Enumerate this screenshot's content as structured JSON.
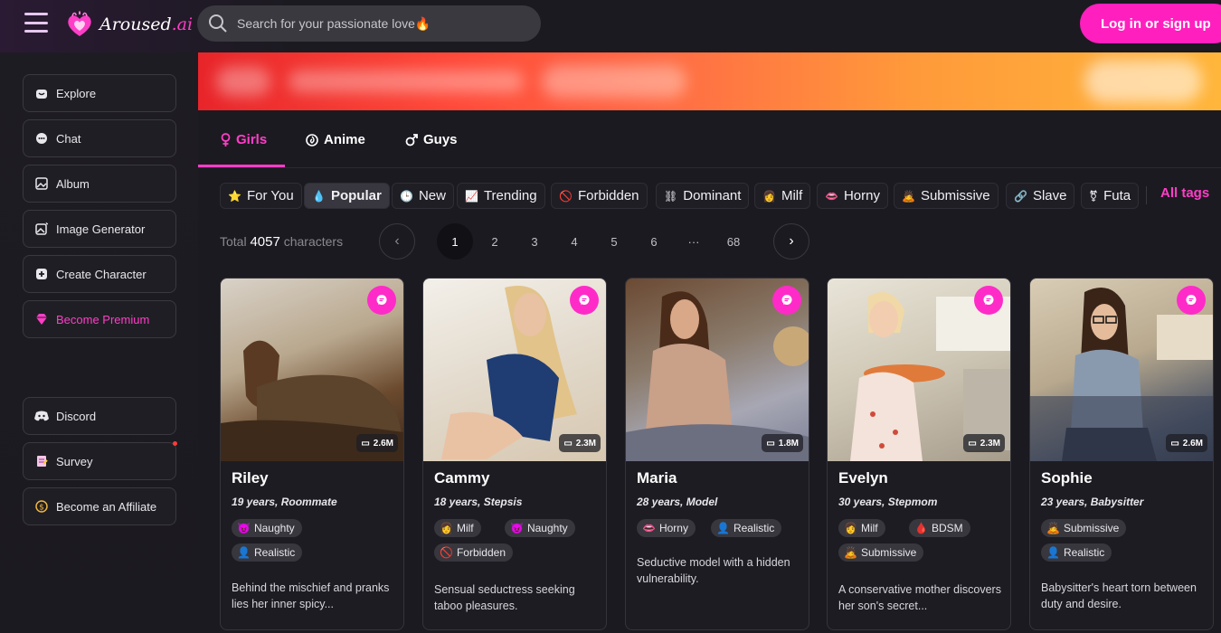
{
  "header": {
    "logo_text": "Aroused",
    "logo_suffix": ".ai",
    "search_placeholder": "Search for your passionate love🔥",
    "login_label": "Log in or sign up"
  },
  "sidebar": {
    "items": [
      {
        "label": "Explore",
        "icon": "home-icon"
      },
      {
        "label": "Chat",
        "icon": "chat-icon"
      },
      {
        "label": "Album",
        "icon": "album-icon"
      },
      {
        "label": "Image Generator",
        "icon": "image-generator-icon"
      },
      {
        "label": "Create Character",
        "icon": "plus-icon"
      },
      {
        "label": "Become Premium",
        "icon": "diamond-icon"
      },
      {
        "label": "Discord",
        "icon": "discord-icon"
      },
      {
        "label": "Survey",
        "icon": "survey-icon"
      },
      {
        "label": "Become an Affiliate",
        "icon": "dollar-icon"
      }
    ]
  },
  "tabs": [
    {
      "label": "Girls",
      "icon": "female-icon"
    },
    {
      "label": "Anime",
      "icon": "anime-icon"
    },
    {
      "label": "Guys",
      "icon": "male-icon"
    }
  ],
  "tags": [
    {
      "label": "For You",
      "emoji": "⭐"
    },
    {
      "label": "Popular",
      "emoji": "💧"
    },
    {
      "label": "New",
      "emoji": "🕒"
    },
    {
      "label": "Trending",
      "emoji": "📈"
    },
    {
      "label": "Forbidden",
      "emoji": "🚫"
    },
    {
      "label": "Dominant",
      "emoji": "⛓"
    },
    {
      "label": "Milf",
      "emoji": "👩"
    },
    {
      "label": "Horny",
      "emoji": "👄"
    },
    {
      "label": "Submissive",
      "emoji": "🙇"
    },
    {
      "label": "Slave",
      "emoji": "🔗"
    },
    {
      "label": "Futa",
      "emoji": "⚧"
    }
  ],
  "all_tags_label": "All tags",
  "total": {
    "prefix": "Total",
    "count": "4057",
    "suffix": "characters"
  },
  "pagination": {
    "pages": [
      "1",
      "2",
      "3",
      "4",
      "5",
      "6",
      "···",
      "68"
    ],
    "current": "1",
    "prev": "‹",
    "next": "›"
  },
  "cards": [
    {
      "name": "Riley",
      "meta": "19 years, Roommate",
      "count": "2.6M",
      "tags": [
        {
          "label": "Naughty",
          "emoji": "😈"
        },
        {
          "label": "Realistic",
          "emoji": "👤"
        }
      ],
      "desc": "Behind the mischief and pranks lies her inner spicy..."
    },
    {
      "name": "Cammy",
      "meta": "18 years, Stepsis",
      "count": "2.3M",
      "tags": [
        {
          "label": "Milf",
          "emoji": "👩"
        },
        {
          "label": "Naughty",
          "emoji": "😈"
        },
        {
          "label": "Forbidden",
          "emoji": "🚫"
        }
      ],
      "desc": "Sensual seductress seeking taboo pleasures."
    },
    {
      "name": "Maria",
      "meta": "28 years, Model",
      "count": "1.8M",
      "tags": [
        {
          "label": "Horny",
          "emoji": "👄"
        },
        {
          "label": "Realistic",
          "emoji": "👤"
        }
      ],
      "desc": "Seductive model with a hidden vulnerability."
    },
    {
      "name": "Evelyn",
      "meta": "30 years, Stepmom",
      "count": "2.3M",
      "tags": [
        {
          "label": "Milf",
          "emoji": "👩"
        },
        {
          "label": "BDSM",
          "emoji": "🩸"
        },
        {
          "label": "Submissive",
          "emoji": "🙇"
        }
      ],
      "desc": "A conservative mother discovers her son's secret..."
    },
    {
      "name": "Sophie",
      "meta": "23 years, Babysitter",
      "count": "2.6M",
      "tags": [
        {
          "label": "Submissive",
          "emoji": "🙇"
        },
        {
          "label": "Realistic",
          "emoji": "👤"
        }
      ],
      "desc": "Babysitter's heart torn between duty and desire."
    }
  ],
  "colors": {
    "accent": "#ff1fbf",
    "background": "#1b1a20",
    "card": "#1d1c22"
  }
}
